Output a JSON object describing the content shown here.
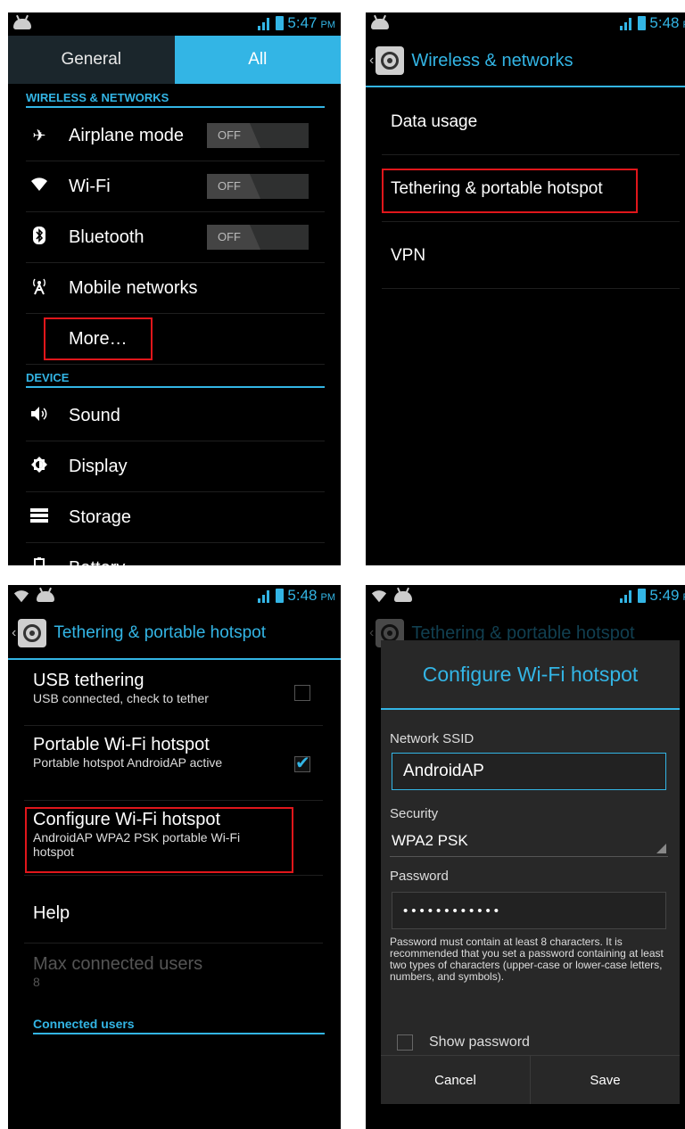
{
  "accent_color": "#33b5e5",
  "highlight_color": "#e0161b",
  "panel1": {
    "time": "5:47",
    "ampm": "PM",
    "tabs": [
      "General",
      "All"
    ],
    "section_wireless": "WIRELESS & NETWORKS",
    "items": [
      {
        "label": "Airplane mode",
        "icon": "airplane-icon",
        "toggle": "OFF"
      },
      {
        "label": "Wi-Fi",
        "icon": "wifi-icon",
        "toggle": "OFF"
      },
      {
        "label": "Bluetooth",
        "icon": "bluetooth-icon",
        "toggle": "OFF"
      },
      {
        "label": "Mobile networks",
        "icon": "mobile-network-icon"
      },
      {
        "label": "More…"
      }
    ],
    "section_device": "DEVICE",
    "device_items": [
      {
        "label": "Sound",
        "icon": "sound-icon"
      },
      {
        "label": "Display",
        "icon": "display-icon"
      },
      {
        "label": "Storage",
        "icon": "storage-icon"
      },
      {
        "label": "Battery",
        "icon": "battery-icon"
      }
    ]
  },
  "panel2": {
    "time": "5:48",
    "ampm": "PM",
    "title": "Wireless & networks",
    "items": [
      "Data usage",
      "Tethering & portable hotspot",
      "VPN"
    ]
  },
  "panel3": {
    "time": "5:48",
    "ampm": "PM",
    "title": "Tethering & portable hotspot",
    "usb": {
      "title": "USB tethering",
      "sub": "USB connected, check to tether"
    },
    "hotspot": {
      "title": "Portable Wi-Fi hotspot",
      "sub": "Portable hotspot AndroidAP active"
    },
    "configure": {
      "title": "Configure Wi-Fi hotspot",
      "sub": "AndroidAP WPA2 PSK portable Wi-Fi hotspot"
    },
    "help": "Help",
    "max_users": {
      "title": "Max connected users",
      "value": "8"
    },
    "connected_users": "Connected users"
  },
  "panel4": {
    "time": "5:49",
    "ampm": "PM",
    "bg_title": "Tethering & portable hotspot",
    "dialog_title": "Configure Wi-Fi hotspot",
    "ssid_label": "Network SSID",
    "ssid_value": "AndroidAP",
    "security_label": "Security",
    "security_value": "WPA2 PSK",
    "password_label": "Password",
    "password_value": "••••••••••••",
    "hint": "Password must contain at least 8 characters. It is recommended that you set a password containing at least two types of characters (upper-case or lower-case letters, numbers, and symbols).",
    "show_password": "Show password",
    "cancel": "Cancel",
    "save": "Save"
  }
}
